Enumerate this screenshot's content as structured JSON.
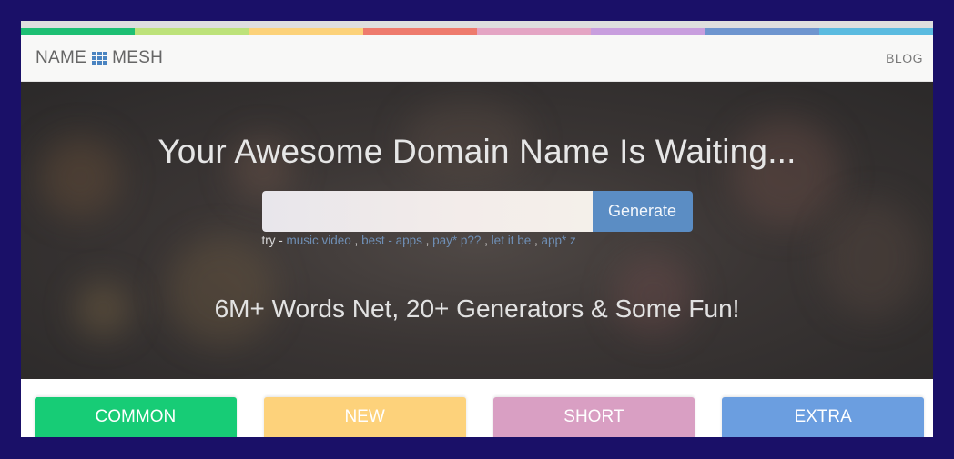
{
  "colors": {
    "strip": [
      "#1dbf73",
      "#bde27a",
      "#fcd27a",
      "#ee7b6d",
      "#e4a5c4",
      "#c89ede",
      "#6e95cf",
      "#5bbbe0"
    ]
  },
  "navbar": {
    "logo_left": "NAME",
    "logo_icon": "grid-icon",
    "logo_right": "MESH",
    "blog_label": "BLOG"
  },
  "hero": {
    "headline": "Your Awesome Domain Name Is Waiting...",
    "search": {
      "value": "",
      "placeholder": ""
    },
    "generate_label": "Generate",
    "try_prefix": "try -",
    "suggestions": [
      "music video",
      "best - apps",
      "pay* p??",
      "let it be",
      "app* z"
    ],
    "tagline": "6M+ Words Net, 20+ Generators & Some Fun!"
  },
  "tabs": [
    {
      "label": "COMMON",
      "color": "#17cc76"
    },
    {
      "label": "NEW",
      "color": "#fdd27b"
    },
    {
      "label": "SHORT",
      "color": "#d99fc3"
    },
    {
      "label": "EXTRA",
      "color": "#6b9ee0"
    }
  ]
}
